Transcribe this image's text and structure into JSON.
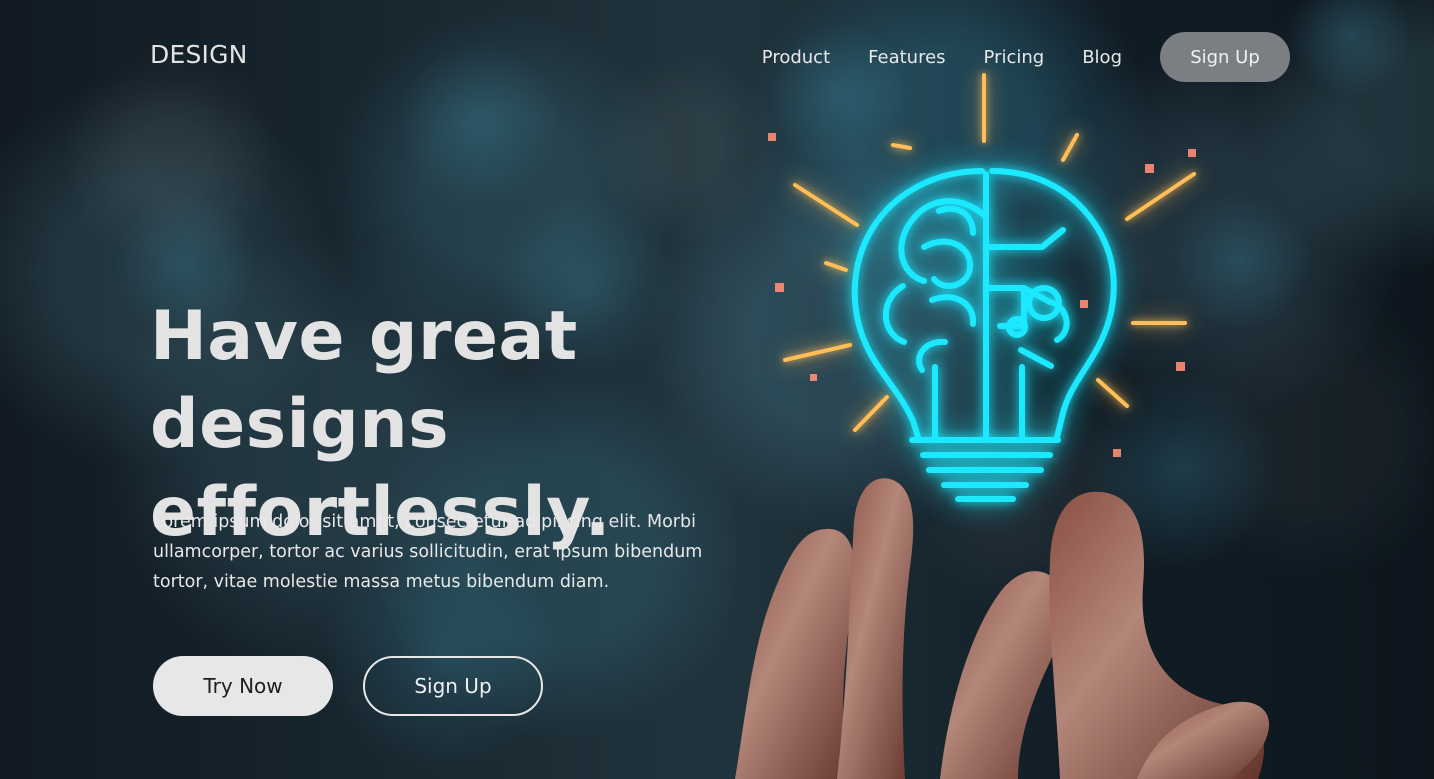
{
  "brand": {
    "logo": "DESIGN"
  },
  "navigation": {
    "items": [
      {
        "label": "Product"
      },
      {
        "label": "Features"
      },
      {
        "label": "Pricing"
      },
      {
        "label": "Blog"
      }
    ],
    "signup_label": "Sign Up"
  },
  "hero": {
    "headline_line_1": "Have great designs",
    "headline_line_2": "effortlessly.",
    "description": "Lorem ipsum dolor sit amet, consectetur adipiscing elit. Morbi ullamcorper, tortor ac varius sollicitudin, erat ipsum bibendum tortor, vitae molestie massa metus bibendum diam.",
    "primary_button": "Try Now",
    "secondary_button": "Sign Up"
  },
  "colors": {
    "background": "#15222a",
    "text": "#e3e3e3",
    "nav_button": "#7b7f84",
    "primary_button": "#e7e7e7",
    "glow": "#1ce9ff",
    "spark": "#ffbe58"
  }
}
